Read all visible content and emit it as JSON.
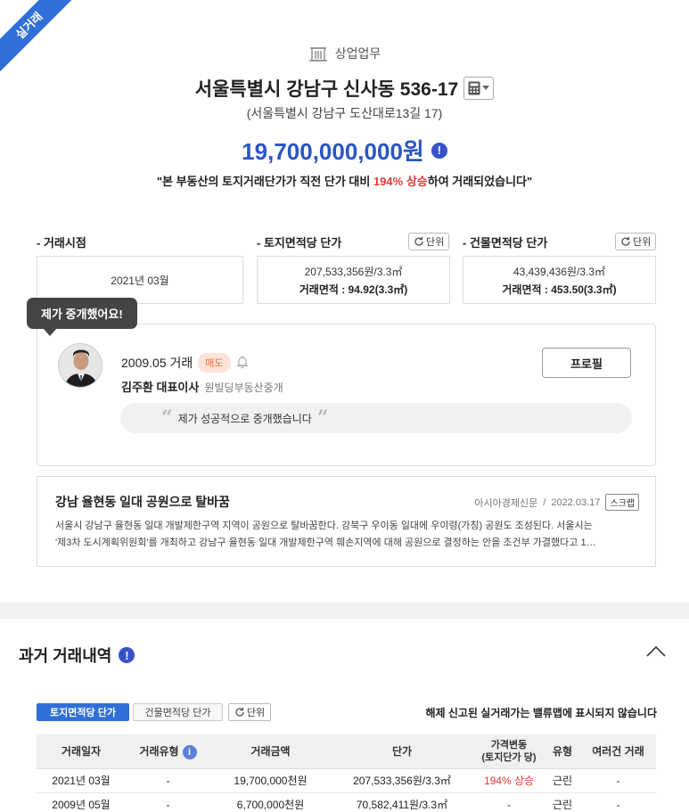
{
  "ribbon": "실거래",
  "category": "상업업무",
  "address": "서울특별시 강남구 신사동 536-17",
  "road_address": "(서울특별시 강남구 도산대로13길 17)",
  "price": "19,700,000,000원",
  "notice": {
    "before": "\"본 부동산의 토지거래단가가 직전 단가 대비 ",
    "highlight": "194% 상승",
    "after": "하여 거래되었습니다\""
  },
  "summary": {
    "deal_time_label": "- 거래시점",
    "deal_time_value": "2021년 03월",
    "land_label": "- 토지면적당 단가",
    "land_unit_btn": "단위",
    "land_price": "207,533,356원/3.3㎡",
    "land_area": "거래면적 : 94.92(3.3㎡)",
    "building_label": "- 건물면적당 단가",
    "building_unit_btn": "단위",
    "building_price": "43,439,436원/3.3㎡",
    "building_area": "거래면적 : 453.50(3.3㎡)"
  },
  "broker": {
    "bubble": "제가 중개했어요!",
    "deal": "2009.05 거래",
    "badge": "매도",
    "name": "김주환 대표이사",
    "office": "원빌딩부동산중개",
    "profile_btn": "프로필",
    "quote": "제가 성공적으로 중개했습니다"
  },
  "news": {
    "title": "강남 율현동 일대 공원으로 탈바꿈",
    "source": "아시아경제신문",
    "date": "2022.03.17",
    "scrap": "스크랩",
    "line1": "서울시 강남구 율현동 일대 개발제한구역 지역이 공원으로 탈바꿈한다. 강북구 우이동 일대에 우이령(가칭) 공원도 조성된다. 서울시는",
    "line2": "'제3차 도시계획위원회'를 개최하고 강남구 율현동 일대 개발제한구역 훼손지역에 대해 공원으로 결정하는 안을 조건부 가결했다고 1…"
  },
  "past": {
    "title": "과거 거래내역",
    "tab_land": "토지면적당 단가",
    "tab_building": "건물면적당 단가",
    "unit_btn": "단위",
    "disclaimer": "해제 신고된 실거래가는 밸류맵에 표시되지 않습니다",
    "headers": [
      "거래일자",
      "거래유형",
      "거래금액",
      "단가",
      "가격변동",
      "(토지단가 당)",
      "유형",
      "여러건 거래"
    ],
    "rows": [
      [
        "2021년 03월",
        "-",
        "19,700,000천원",
        "207,533,356원/3.3㎡",
        "194% 상승",
        "근린",
        "-"
      ],
      [
        "2009년 05월",
        "-",
        "6,700,000천원",
        "70,582,411원/3.3㎡",
        "-",
        "근린",
        "-"
      ]
    ]
  },
  "colors": {
    "accent": "#2f6fd8",
    "price": "#2a55c4",
    "rise": "#e53b3b"
  }
}
